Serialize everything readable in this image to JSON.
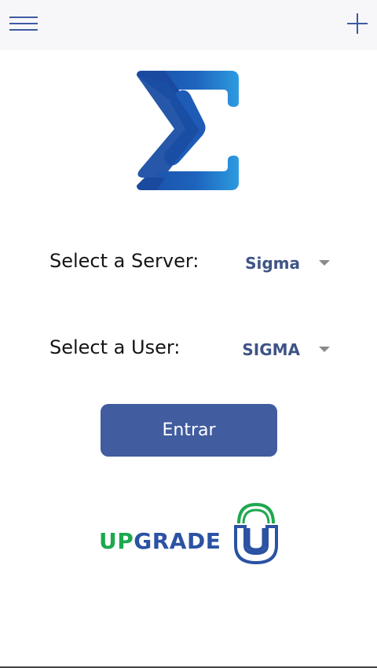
{
  "header": {
    "menu_icon": "hamburger-menu-icon",
    "add_icon": "plus-icon"
  },
  "logo": {
    "icon": "sigma-logo-icon",
    "colors": {
      "dark_blue": "#1c4fa7",
      "light_blue": "#2d9be0"
    }
  },
  "form": {
    "server_label": "Select a Server:",
    "server_value": "Sigma",
    "user_label": "Select a User:",
    "user_value": "SIGMA",
    "enter_label": "Entrar"
  },
  "brand": {
    "up": "UP",
    "grade": "GRADE",
    "mark_icon": "upgrade-shield-u-icon",
    "colors": {
      "green": "#1ea84f",
      "blue": "#2b52a3"
    }
  },
  "colors": {
    "accent": "#415c9f",
    "select_text": "#3f5486",
    "topbar_bg": "#f7f7f9"
  }
}
